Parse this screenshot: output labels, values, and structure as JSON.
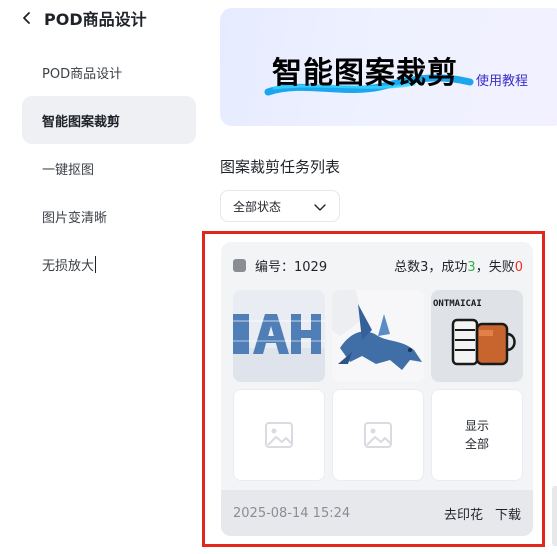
{
  "sidebar": {
    "title": "POD商品设计",
    "items": [
      {
        "label": "POD商品设计"
      },
      {
        "label": "智能图案裁剪"
      },
      {
        "label": "一键抠图"
      },
      {
        "label": "图片变清晰"
      },
      {
        "label": "无损放大"
      }
    ]
  },
  "banner": {
    "title": "智能图案裁剪",
    "link": "使用教程"
  },
  "tasks": {
    "section_title": "图案裁剪任务列表",
    "filter": {
      "selected": "全部状态"
    },
    "card": {
      "id_label": "编号：",
      "id_value": "1029",
      "total_label": "总数",
      "total_value": "3",
      "sep1": "，",
      "success_label": "成功",
      "success_value": "3",
      "sep2": "，",
      "fail_label": "失败",
      "fail_value": "0",
      "show_all_line1": "显示",
      "show_all_line2": "全部",
      "thumb3_text": "ONTMAICAI",
      "timestamp": "2025-08-14 15:24",
      "action_watermark": "去印花",
      "action_download": "下载"
    }
  },
  "colors": {
    "accent_link": "#3a2cc8",
    "success": "#2db34a",
    "fail": "#f2302a",
    "highlight_frame": "#e3261b"
  }
}
